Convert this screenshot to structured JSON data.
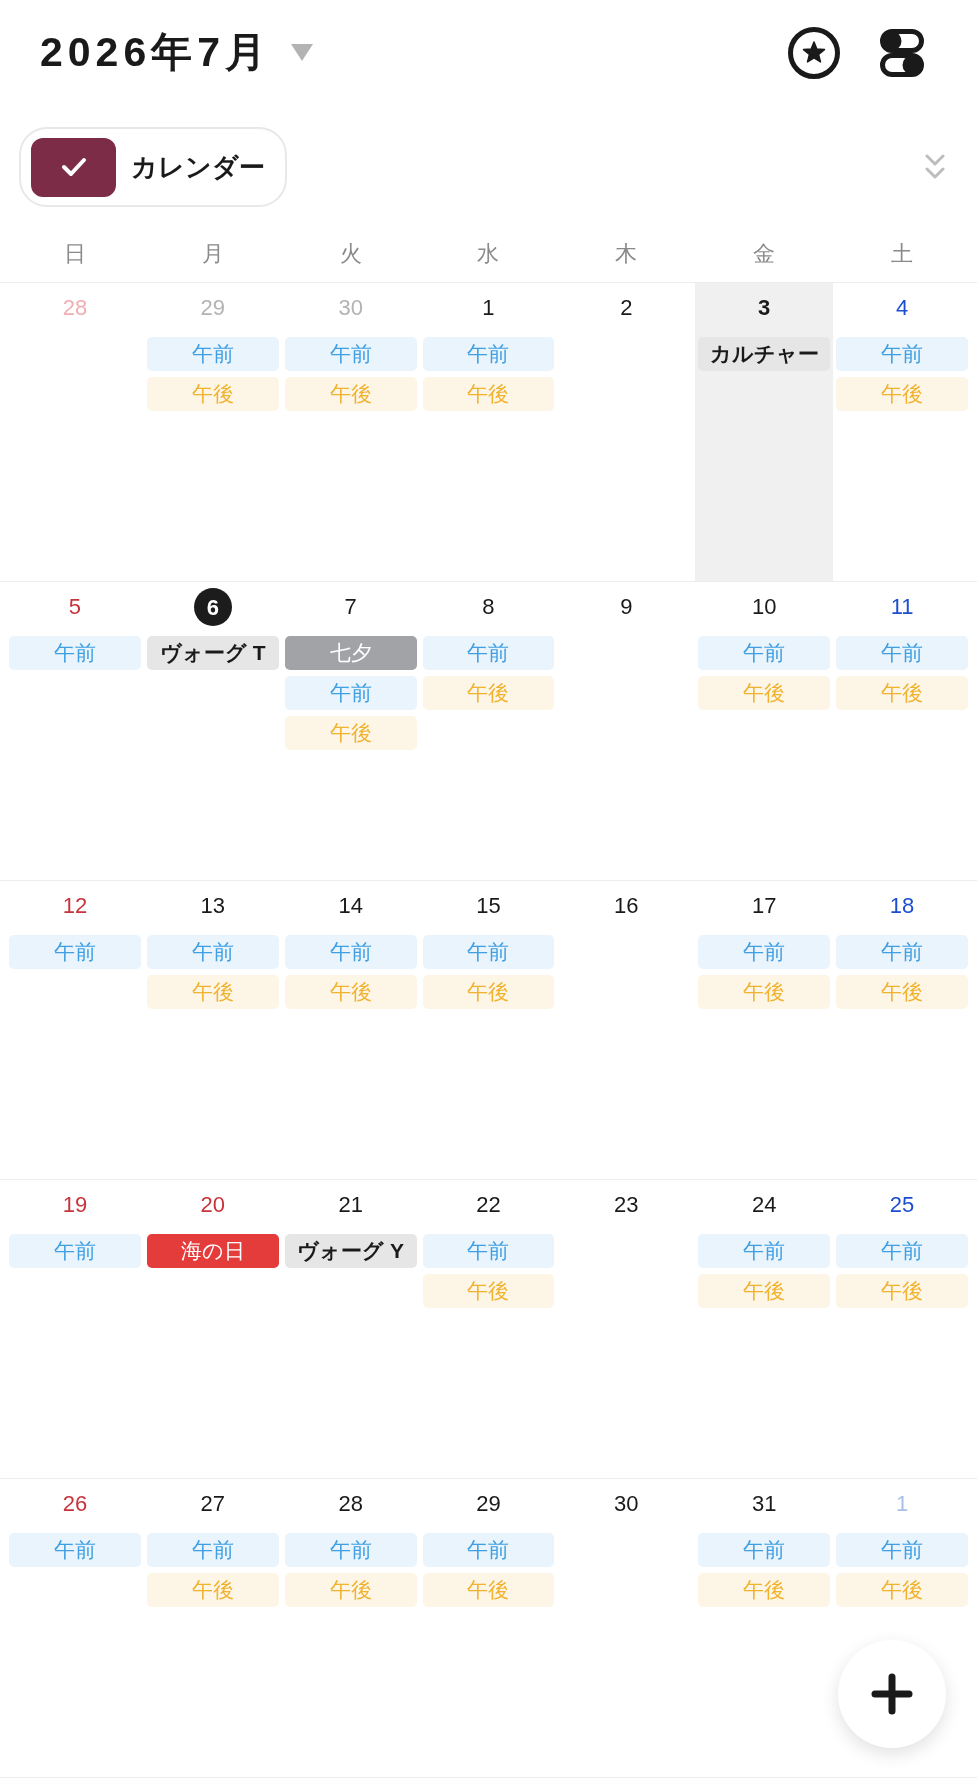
{
  "header": {
    "title": "2026年7月"
  },
  "calendars": [
    {
      "label": "カレンダー",
      "checked": true,
      "color": "#7d2c47"
    }
  ],
  "weekdays": [
    "日",
    "月",
    "火",
    "水",
    "木",
    "金",
    "土"
  ],
  "weeks": [
    [
      {
        "day": "28",
        "kind": "sunday",
        "outside": true,
        "today": false,
        "selected": false
      },
      {
        "day": "29",
        "kind": "weekday",
        "outside": true,
        "today": false,
        "selected": false,
        "events": [
          {
            "label": "午前",
            "kind": "am"
          },
          {
            "label": "午後",
            "kind": "pm"
          }
        ]
      },
      {
        "day": "30",
        "kind": "weekday",
        "outside": true,
        "today": false,
        "selected": false,
        "events": [
          {
            "label": "午前",
            "kind": "am"
          },
          {
            "label": "午後",
            "kind": "pm"
          }
        ]
      },
      {
        "day": "1",
        "kind": "weekday",
        "outside": false,
        "today": false,
        "selected": false,
        "events": [
          {
            "label": "午前",
            "kind": "am"
          },
          {
            "label": "午後",
            "kind": "pm"
          }
        ]
      },
      {
        "day": "2",
        "kind": "weekday",
        "outside": false,
        "today": false,
        "selected": false
      },
      {
        "day": "3",
        "kind": "weekday",
        "outside": false,
        "today": false,
        "selected": true,
        "events": [
          {
            "label": "カルチャー",
            "kind": "event"
          }
        ]
      },
      {
        "day": "4",
        "kind": "saturday",
        "outside": false,
        "today": false,
        "selected": false,
        "events": [
          {
            "label": "午前",
            "kind": "am"
          },
          {
            "label": "午後",
            "kind": "pm"
          }
        ]
      }
    ],
    [
      {
        "day": "5",
        "kind": "sunday",
        "outside": false,
        "today": false,
        "selected": false,
        "events": [
          {
            "label": "午前",
            "kind": "am"
          }
        ]
      },
      {
        "day": "6",
        "kind": "weekday",
        "outside": false,
        "today": true,
        "selected": false,
        "events": [
          {
            "label": "ヴォーグ T",
            "kind": "event"
          }
        ]
      },
      {
        "day": "7",
        "kind": "weekday",
        "outside": false,
        "today": false,
        "selected": false,
        "events": [
          {
            "label": "七夕",
            "kind": "observance"
          },
          {
            "label": "午前",
            "kind": "am"
          },
          {
            "label": "午後",
            "kind": "pm"
          }
        ]
      },
      {
        "day": "8",
        "kind": "weekday",
        "outside": false,
        "today": false,
        "selected": false,
        "events": [
          {
            "label": "午前",
            "kind": "am"
          },
          {
            "label": "午後",
            "kind": "pm"
          }
        ]
      },
      {
        "day": "9",
        "kind": "weekday",
        "outside": false,
        "today": false,
        "selected": false
      },
      {
        "day": "10",
        "kind": "weekday",
        "outside": false,
        "today": false,
        "selected": false,
        "events": [
          {
            "label": "午前",
            "kind": "am"
          },
          {
            "label": "午後",
            "kind": "pm"
          }
        ]
      },
      {
        "day": "11",
        "kind": "saturday",
        "outside": false,
        "today": false,
        "selected": false,
        "events": [
          {
            "label": "午前",
            "kind": "am"
          },
          {
            "label": "午後",
            "kind": "pm"
          }
        ]
      }
    ],
    [
      {
        "day": "12",
        "kind": "sunday",
        "outside": false,
        "today": false,
        "selected": false,
        "events": [
          {
            "label": "午前",
            "kind": "am"
          }
        ]
      },
      {
        "day": "13",
        "kind": "weekday",
        "outside": false,
        "today": false,
        "selected": false,
        "events": [
          {
            "label": "午前",
            "kind": "am"
          },
          {
            "label": "午後",
            "kind": "pm"
          }
        ]
      },
      {
        "day": "14",
        "kind": "weekday",
        "outside": false,
        "today": false,
        "selected": false,
        "events": [
          {
            "label": "午前",
            "kind": "am"
          },
          {
            "label": "午後",
            "kind": "pm"
          }
        ]
      },
      {
        "day": "15",
        "kind": "weekday",
        "outside": false,
        "today": false,
        "selected": false,
        "events": [
          {
            "label": "午前",
            "kind": "am"
          },
          {
            "label": "午後",
            "kind": "pm"
          }
        ]
      },
      {
        "day": "16",
        "kind": "weekday",
        "outside": false,
        "today": false,
        "selected": false
      },
      {
        "day": "17",
        "kind": "weekday",
        "outside": false,
        "today": false,
        "selected": false,
        "events": [
          {
            "label": "午前",
            "kind": "am"
          },
          {
            "label": "午後",
            "kind": "pm"
          }
        ]
      },
      {
        "day": "18",
        "kind": "saturday",
        "outside": false,
        "today": false,
        "selected": false,
        "events": [
          {
            "label": "午前",
            "kind": "am"
          },
          {
            "label": "午後",
            "kind": "pm"
          }
        ]
      }
    ],
    [
      {
        "day": "19",
        "kind": "sunday",
        "outside": false,
        "today": false,
        "selected": false,
        "events": [
          {
            "label": "午前",
            "kind": "am"
          }
        ]
      },
      {
        "day": "20",
        "kind": "holiday",
        "outside": false,
        "today": false,
        "selected": false,
        "events": [
          {
            "label": "海の日",
            "kind": "holiday"
          }
        ]
      },
      {
        "day": "21",
        "kind": "weekday",
        "outside": false,
        "today": false,
        "selected": false,
        "events": [
          {
            "label": "ヴォーグ Y",
            "kind": "event"
          }
        ]
      },
      {
        "day": "22",
        "kind": "weekday",
        "outside": false,
        "today": false,
        "selected": false,
        "events": [
          {
            "label": "午前",
            "kind": "am"
          },
          {
            "label": "午後",
            "kind": "pm"
          }
        ]
      },
      {
        "day": "23",
        "kind": "weekday",
        "outside": false,
        "today": false,
        "selected": false
      },
      {
        "day": "24",
        "kind": "weekday",
        "outside": false,
        "today": false,
        "selected": false,
        "events": [
          {
            "label": "午前",
            "kind": "am"
          },
          {
            "label": "午後",
            "kind": "pm"
          }
        ]
      },
      {
        "day": "25",
        "kind": "saturday",
        "outside": false,
        "today": false,
        "selected": false,
        "events": [
          {
            "label": "午前",
            "kind": "am"
          },
          {
            "label": "午後",
            "kind": "pm"
          }
        ]
      }
    ],
    [
      {
        "day": "26",
        "kind": "sunday",
        "outside": false,
        "today": false,
        "selected": false,
        "events": [
          {
            "label": "午前",
            "kind": "am"
          }
        ]
      },
      {
        "day": "27",
        "kind": "weekday",
        "outside": false,
        "today": false,
        "selected": false,
        "events": [
          {
            "label": "午前",
            "kind": "am"
          },
          {
            "label": "午後",
            "kind": "pm"
          }
        ]
      },
      {
        "day": "28",
        "kind": "weekday",
        "outside": false,
        "today": false,
        "selected": false,
        "events": [
          {
            "label": "午前",
            "kind": "am"
          },
          {
            "label": "午後",
            "kind": "pm"
          }
        ]
      },
      {
        "day": "29",
        "kind": "weekday",
        "outside": false,
        "today": false,
        "selected": false,
        "events": [
          {
            "label": "午前",
            "kind": "am"
          },
          {
            "label": "午後",
            "kind": "pm"
          }
        ]
      },
      {
        "day": "30",
        "kind": "weekday",
        "outside": false,
        "today": false,
        "selected": false
      },
      {
        "day": "31",
        "kind": "weekday",
        "outside": false,
        "today": false,
        "selected": false,
        "events": [
          {
            "label": "午前",
            "kind": "am"
          },
          {
            "label": "午後",
            "kind": "pm"
          }
        ]
      },
      {
        "day": "1",
        "kind": "saturday",
        "outside": true,
        "today": false,
        "selected": false,
        "events": [
          {
            "label": "午前",
            "kind": "am"
          },
          {
            "label": "午後",
            "kind": "pm"
          }
        ]
      }
    ]
  ]
}
